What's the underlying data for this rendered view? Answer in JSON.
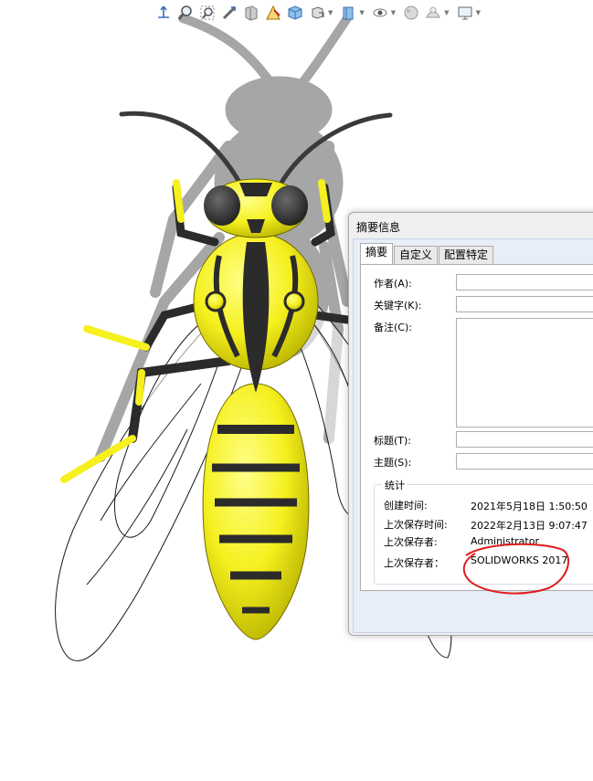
{
  "toolbar": {
    "icons": [
      "view-orientation-icon",
      "zoom-to-fit-icon",
      "zoom-area-icon",
      "previous-view-icon",
      "section-view-icon",
      "dynamic-annotation-icon",
      "view-cube-icon",
      "view-orientation-dropdown-icon",
      "display-style-icon",
      "hide-show-icon",
      "edit-appearance-icon",
      "apply-scene-icon",
      "view-settings-icon"
    ]
  },
  "dialog": {
    "title": "摘要信息",
    "tabs": [
      "摘要",
      "自定义",
      "配置特定"
    ],
    "fields": {
      "author_label": "作者(A):",
      "keywords_label": "关键字(K):",
      "comments_label": "备注(C):",
      "title_label": "标题(T):",
      "subject_label": "主题(S):"
    },
    "stats": {
      "group_label": "统计",
      "created_label": "创建时间:",
      "created_value": "2021年5月18日 1:50:50",
      "last_saved_time_label": "上次保存时间:",
      "last_saved_time_value": "2022年2月13日 9:07:47",
      "last_saved_by_label": "上次保存者:",
      "last_saved_by_value": "Administrator",
      "last_saved_with_label": "上次保存者：",
      "last_saved_with_value": "SOLIDWORKS 2017"
    }
  },
  "colors": {
    "wasp_yellow": "#f5f01e",
    "wasp_black": "#2b2b2b",
    "shadow": "#a6a6a6",
    "annotation_red": "#e01c1c"
  }
}
